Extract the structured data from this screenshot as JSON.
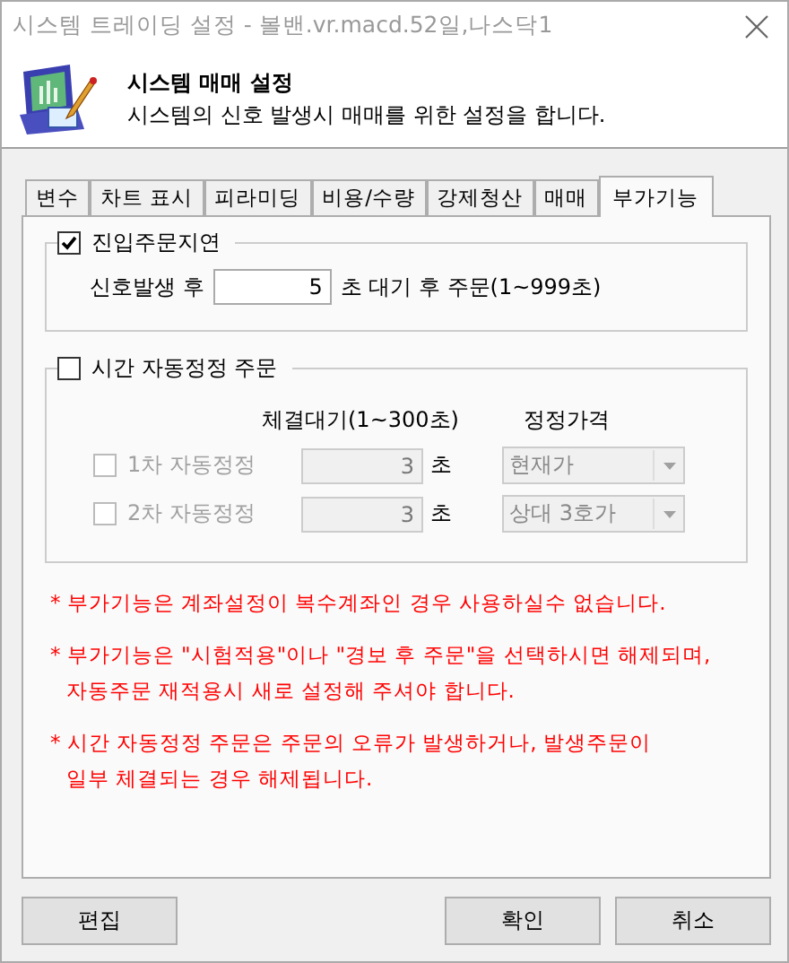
{
  "window": {
    "title": "시스템 트레이딩 설정 - 볼밴.vr.macd.52일,나스닥1"
  },
  "header": {
    "title": "시스템 매매 설정",
    "subtitle": "시스템의 신호 발생시 매매를 위한 설정을 합니다."
  },
  "tabs": [
    {
      "label": "변수",
      "selected": false
    },
    {
      "label": "차트 표시",
      "selected": false
    },
    {
      "label": "피라미딩",
      "selected": false
    },
    {
      "label": "비용/수량",
      "selected": false
    },
    {
      "label": "강제청산",
      "selected": false
    },
    {
      "label": "매매",
      "selected": false
    },
    {
      "label": "부가기능",
      "selected": true
    }
  ],
  "entry_delay": {
    "label": "진입주문지연",
    "checked": true,
    "prefix": "신호발생 후",
    "value": "5",
    "suffix": "초 대기 후 주문(1~999초)"
  },
  "auto_modify": {
    "label": "시간 자동정정 주문",
    "checked": false,
    "columns": [
      "체결대기(1~300초)",
      "정정가격"
    ],
    "rows": [
      {
        "label": "1차 자동정정",
        "checked": false,
        "disabled": true,
        "wait": "3",
        "unit": "초",
        "price": "현재가"
      },
      {
        "label": "2차 자동정정",
        "checked": false,
        "disabled": true,
        "wait": "3",
        "unit": "초",
        "price": "상대 3호가"
      }
    ]
  },
  "notes": [
    {
      "lines": [
        "* 부가기능은 계좌설정이 복수계좌인 경우 사용하실수 없습니다."
      ]
    },
    {
      "lines": [
        "* 부가기능은 \"시험적용\"이나 \"경보 후 주문\"을 선택하시면 해제되며,",
        "자동주문 재적용시 새로 설정해 주셔야 합니다."
      ]
    },
    {
      "lines": [
        "* 시간 자동정정 주문은 주문의 오류가 발생하거나, 발생주문이",
        "일부 체결되는 경우 해제됩니다."
      ]
    }
  ],
  "left_buttons": [
    "편집"
  ],
  "right_buttons": [
    "확인",
    "취소"
  ]
}
